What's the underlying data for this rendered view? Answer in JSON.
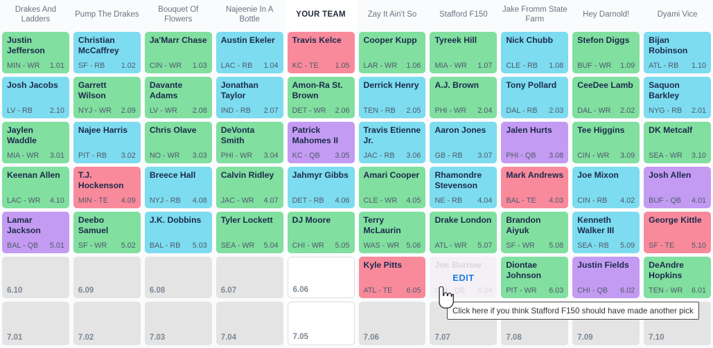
{
  "board": {
    "team_headers": [
      "Drakes And Ladders",
      "Pump The Drakes",
      "Bouquet Of Flowers",
      "Najeenie In A Bottle",
      "YOUR TEAM",
      "Zay It Ain't So",
      "Stafford F150",
      "Jake Fromm State Farm",
      "Hey Darnold!",
      "Dyami Vice"
    ],
    "your_team_index": 4,
    "position_colors": {
      "WR": "#81dfa0",
      "RB": "#7ddcf0",
      "QB": "#c49bf2",
      "TE": "#f98a9c",
      "empty": "#e4e4e4"
    },
    "rows": [
      [
        {
          "name": "Justin Jefferson",
          "team": "MIN",
          "pos": "WR",
          "pick": "1.01"
        },
        {
          "name": "Christian McCaffrey",
          "team": "SF",
          "pos": "RB",
          "pick": "1.02"
        },
        {
          "name": "Ja'Marr Chase",
          "team": "CIN",
          "pos": "WR",
          "pick": "1.03"
        },
        {
          "name": "Austin Ekeler",
          "team": "LAC",
          "pos": "RB",
          "pick": "1.04"
        },
        {
          "name": "Travis Kelce",
          "team": "KC",
          "pos": "TE",
          "pick": "1.05"
        },
        {
          "name": "Cooper Kupp",
          "team": "LAR",
          "pos": "WR",
          "pick": "1.06"
        },
        {
          "name": "Tyreek Hill",
          "team": "MIA",
          "pos": "WR",
          "pick": "1.07"
        },
        {
          "name": "Nick Chubb",
          "team": "CLE",
          "pos": "RB",
          "pick": "1.08"
        },
        {
          "name": "Stefon Diggs",
          "team": "BUF",
          "pos": "WR",
          "pick": "1.09"
        },
        {
          "name": "Bijan Robinson",
          "team": "ATL",
          "pos": "RB",
          "pick": "1.10"
        }
      ],
      [
        {
          "name": "Josh Jacobs",
          "team": "LV",
          "pos": "RB",
          "pick": "2.10"
        },
        {
          "name": "Garrett Wilson",
          "team": "NYJ",
          "pos": "WR",
          "pick": "2.09"
        },
        {
          "name": "Davante Adams",
          "team": "LV",
          "pos": "WR",
          "pick": "2.08"
        },
        {
          "name": "Jonathan Taylor",
          "team": "IND",
          "pos": "RB",
          "pick": "2.07"
        },
        {
          "name": "Amon-Ra St. Brown",
          "team": "DET",
          "pos": "WR",
          "pick": "2.06"
        },
        {
          "name": "Derrick Henry",
          "team": "TEN",
          "pos": "RB",
          "pick": "2.05"
        },
        {
          "name": "A.J. Brown",
          "team": "PHI",
          "pos": "WR",
          "pick": "2.04"
        },
        {
          "name": "Tony Pollard",
          "team": "DAL",
          "pos": "RB",
          "pick": "2.03"
        },
        {
          "name": "CeeDee Lamb",
          "team": "DAL",
          "pos": "WR",
          "pick": "2.02"
        },
        {
          "name": "Saquon Barkley",
          "team": "NYG",
          "pos": "RB",
          "pick": "2.01"
        }
      ],
      [
        {
          "name": "Jaylen Waddle",
          "team": "MIA",
          "pos": "WR",
          "pick": "3.01"
        },
        {
          "name": "Najee Harris",
          "team": "PIT",
          "pos": "RB",
          "pick": "3.02"
        },
        {
          "name": "Chris Olave",
          "team": "NO",
          "pos": "WR",
          "pick": "3.03"
        },
        {
          "name": "DeVonta Smith",
          "team": "PHI",
          "pos": "WR",
          "pick": "3.04"
        },
        {
          "name": "Patrick Mahomes II",
          "team": "KC",
          "pos": "QB",
          "pick": "3.05"
        },
        {
          "name": "Travis Etienne Jr.",
          "team": "JAC",
          "pos": "RB",
          "pick": "3.06"
        },
        {
          "name": "Aaron Jones",
          "team": "GB",
          "pos": "RB",
          "pick": "3.07"
        },
        {
          "name": "Jalen Hurts",
          "team": "PHI",
          "pos": "QB",
          "pick": "3.08"
        },
        {
          "name": "Tee Higgins",
          "team": "CIN",
          "pos": "WR",
          "pick": "3.09"
        },
        {
          "name": "DK Metcalf",
          "team": "SEA",
          "pos": "WR",
          "pick": "3.10"
        }
      ],
      [
        {
          "name": "Keenan Allen",
          "team": "LAC",
          "pos": "WR",
          "pick": "4.10"
        },
        {
          "name": "T.J. Hockenson",
          "team": "MIN",
          "pos": "TE",
          "pick": "4.09"
        },
        {
          "name": "Breece Hall",
          "team": "NYJ",
          "pos": "RB",
          "pick": "4.08"
        },
        {
          "name": "Calvin Ridley",
          "team": "JAC",
          "pos": "WR",
          "pick": "4.07"
        },
        {
          "name": "Jahmyr Gibbs",
          "team": "DET",
          "pos": "RB",
          "pick": "4.06"
        },
        {
          "name": "Amari Cooper",
          "team": "CLE",
          "pos": "WR",
          "pick": "4.05"
        },
        {
          "name": "Rhamondre Stevenson",
          "team": "NE",
          "pos": "RB",
          "pick": "4.04"
        },
        {
          "name": "Mark Andrews",
          "team": "BAL",
          "pos": "TE",
          "pick": "4.03"
        },
        {
          "name": "Joe Mixon",
          "team": "CIN",
          "pos": "RB",
          "pick": "4.02"
        },
        {
          "name": "Josh Allen",
          "team": "BUF",
          "pos": "QB",
          "pick": "4.01"
        }
      ],
      [
        {
          "name": "Lamar Jackson",
          "team": "BAL",
          "pos": "QB",
          "pick": "5.01"
        },
        {
          "name": "Deebo Samuel",
          "team": "SF",
          "pos": "WR",
          "pick": "5.02"
        },
        {
          "name": "J.K. Dobbins",
          "team": "BAL",
          "pos": "RB",
          "pick": "5.03"
        },
        {
          "name": "Tyler Lockett",
          "team": "SEA",
          "pos": "WR",
          "pick": "5.04"
        },
        {
          "name": "DJ Moore",
          "team": "CHI",
          "pos": "WR",
          "pick": "5.05"
        },
        {
          "name": "Terry McLaurin",
          "team": "WAS",
          "pos": "WR",
          "pick": "5.06"
        },
        {
          "name": "Drake London",
          "team": "ATL",
          "pos": "WR",
          "pick": "5.07"
        },
        {
          "name": "Brandon Aiyuk",
          "team": "SF",
          "pos": "WR",
          "pick": "5.08"
        },
        {
          "name": "Kenneth Walker III",
          "team": "SEA",
          "pos": "RB",
          "pick": "5.09"
        },
        {
          "name": "George Kittle",
          "team": "SF",
          "pos": "TE",
          "pick": "5.10"
        }
      ],
      [
        {
          "name": "",
          "team": "",
          "pos": "empty",
          "pick": "6.10"
        },
        {
          "name": "",
          "team": "",
          "pos": "empty",
          "pick": "6.09"
        },
        {
          "name": "",
          "team": "",
          "pos": "empty",
          "pick": "6.08"
        },
        {
          "name": "",
          "team": "",
          "pos": "empty",
          "pick": "6.07"
        },
        {
          "name": "",
          "team": "",
          "pos": "empty",
          "pick": "6.06"
        },
        {
          "name": "Kyle Pitts",
          "team": "ATL",
          "pos": "TE",
          "pick": "6.05"
        },
        {
          "name": "Joe Burrow",
          "team": "CIN",
          "pos": "QB",
          "pick": "6.04",
          "hovered": true
        },
        {
          "name": "Diontae Johnson",
          "team": "PIT",
          "pos": "WR",
          "pick": "6.03"
        },
        {
          "name": "Justin Fields",
          "team": "CHI",
          "pos": "QB",
          "pick": "6.02"
        },
        {
          "name": "DeAndre Hopkins",
          "team": "TEN",
          "pos": "WR",
          "pick": "6.01"
        }
      ],
      [
        {
          "name": "",
          "team": "",
          "pos": "empty",
          "pick": "7.01"
        },
        {
          "name": "",
          "team": "",
          "pos": "empty",
          "pick": "7.02"
        },
        {
          "name": "",
          "team": "",
          "pos": "empty",
          "pick": "7.03"
        },
        {
          "name": "",
          "team": "",
          "pos": "empty",
          "pick": "7.04"
        },
        {
          "name": "",
          "team": "",
          "pos": "empty",
          "pick": "7.05"
        },
        {
          "name": "",
          "team": "",
          "pos": "empty",
          "pick": "7.06"
        },
        {
          "name": "",
          "team": "",
          "pos": "empty",
          "pick": "7.07"
        },
        {
          "name": "",
          "team": "",
          "pos": "empty",
          "pick": "7.08"
        },
        {
          "name": "",
          "team": "",
          "pos": "empty",
          "pick": "7.09"
        },
        {
          "name": "",
          "team": "",
          "pos": "empty",
          "pick": "7.10"
        }
      ]
    ]
  },
  "overlay": {
    "edit_label": "EDIT",
    "tooltip_text": "Click here if you think Stafford F150 should have made another pick",
    "edit_color": "#1f7ae0"
  }
}
